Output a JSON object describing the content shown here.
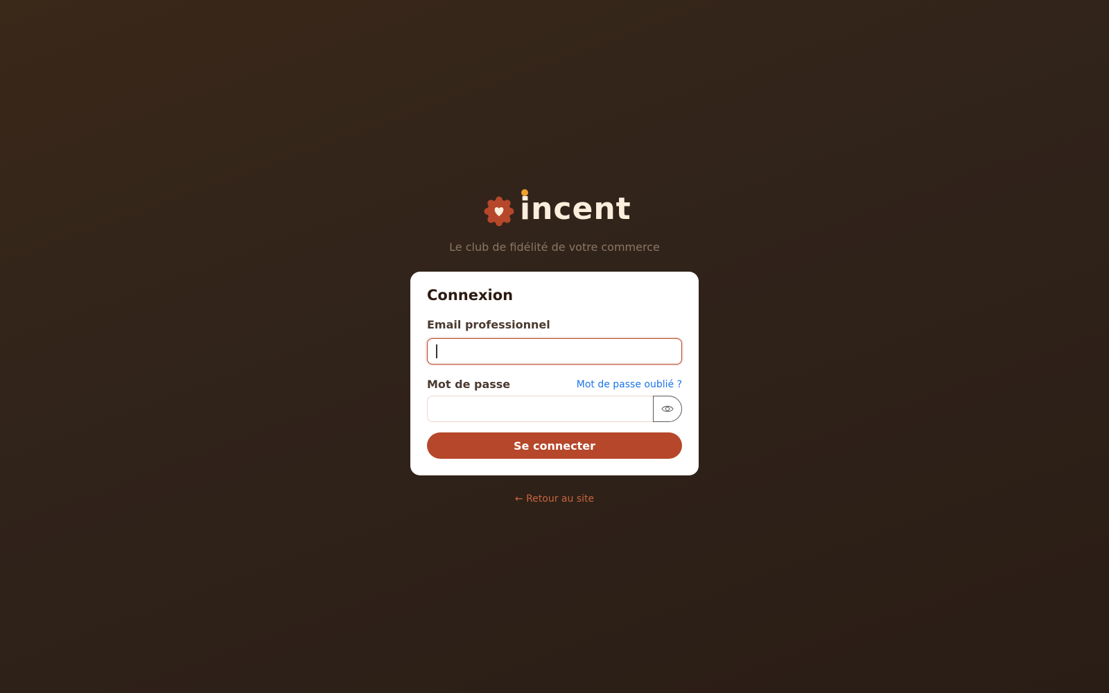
{
  "brand": {
    "name": "incent",
    "tagline": "Le club de fidélité de votre commerce",
    "logo_icon": "heart-badge-icon"
  },
  "login": {
    "title": "Connexion",
    "email_label": "Email professionnel",
    "email_value": "",
    "password_label": "Mot de passe",
    "password_value": "",
    "forgot_link": "Mot de passe oublié ?",
    "toggle_visibility_icon": "eye-icon",
    "submit_label": "Se connecter"
  },
  "footer": {
    "back_link": "← Retour au site"
  },
  "colors": {
    "accent": "#b6472a",
    "dot": "#f0a030",
    "link": "#1a73e8",
    "back_link": "#c8653d",
    "text_light": "#fbeedd"
  }
}
